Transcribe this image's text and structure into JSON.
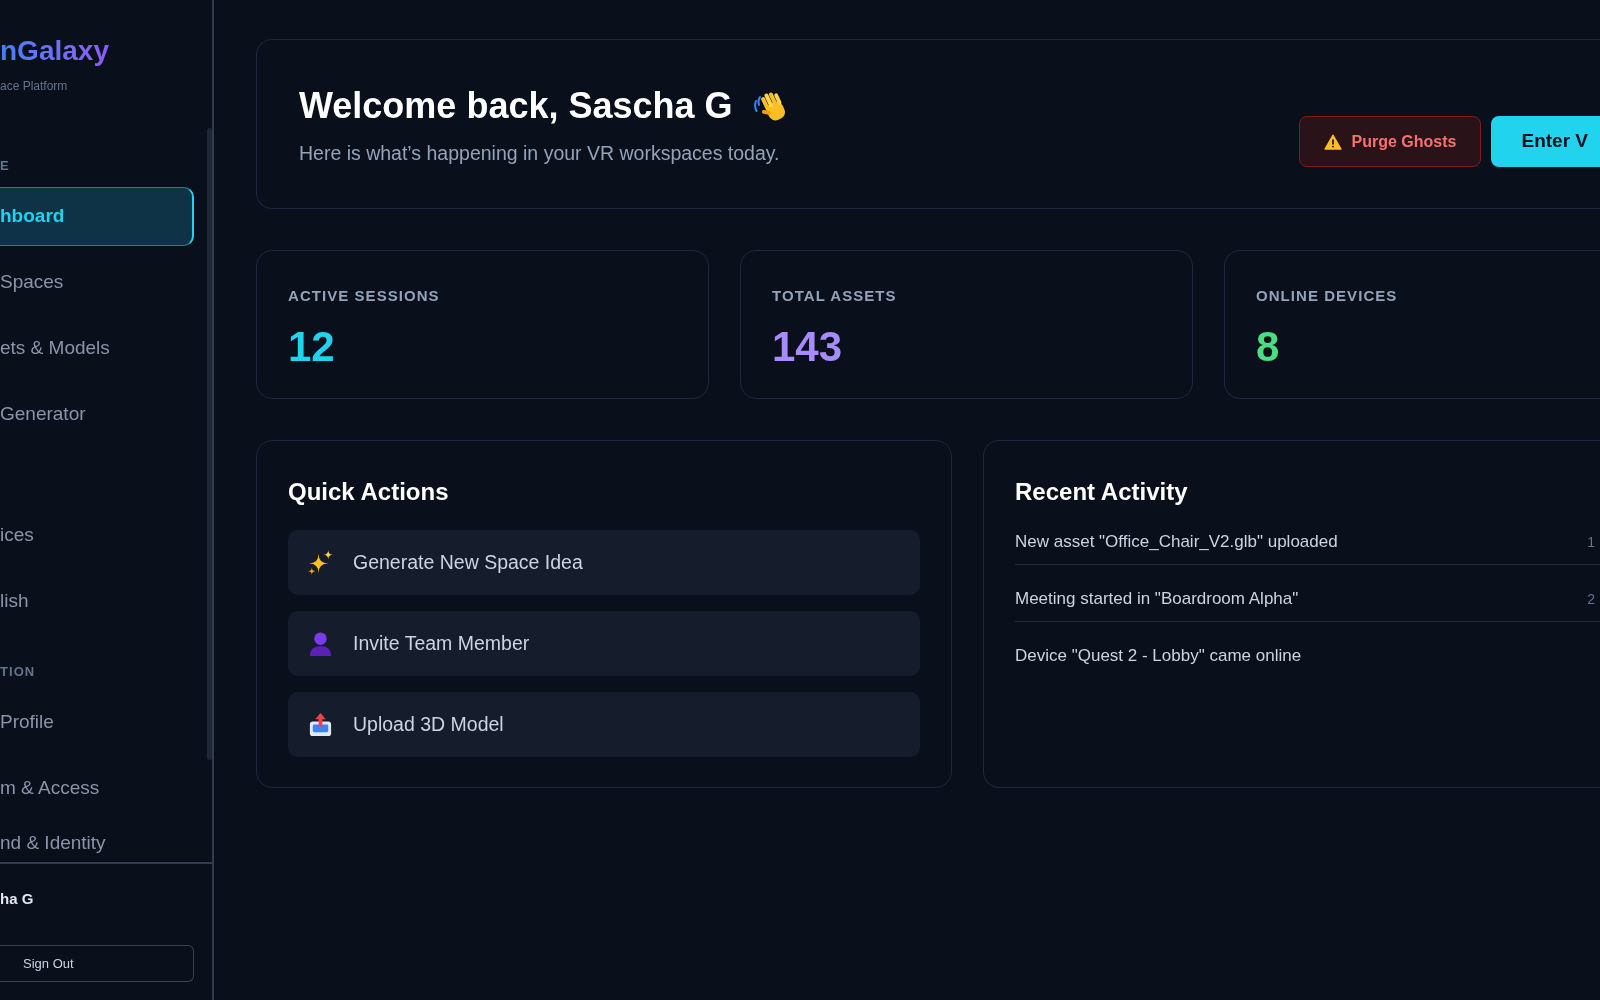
{
  "sidebar": {
    "logo": "nGalaxy",
    "tagline": "ace Platform",
    "sections": [
      {
        "label": "E",
        "items": [
          {
            "label": "hboard",
            "selected": true
          },
          {
            "label": "Spaces",
            "selected": false
          },
          {
            "label": "ets & Models",
            "selected": false
          },
          {
            "label": "Generator",
            "selected": false
          }
        ]
      },
      {
        "items": [
          {
            "label": "ices",
            "selected": false
          },
          {
            "label": "lish",
            "selected": false
          }
        ]
      },
      {
        "label": "TION",
        "items": [
          {
            "label": "Profile",
            "selected": false
          },
          {
            "label": "m & Access",
            "selected": false
          },
          {
            "label": "nd & Identity",
            "selected": false
          }
        ]
      }
    ],
    "user": {
      "name": "ha G"
    },
    "sign_out": "Sign Out"
  },
  "header": {
    "title": "Welcome back, Sascha G",
    "subtitle": "Here is what’s happening in your VR workspaces today.",
    "buttons": [
      {
        "label": "Purge Ghosts",
        "kind": "danger"
      },
      {
        "label": "Enter V",
        "kind": "primary"
      }
    ]
  },
  "stats": [
    {
      "label": "ACTIVE SESSIONS",
      "value": "12",
      "color": "#22d3ee"
    },
    {
      "label": "TOTAL ASSETS",
      "value": "143",
      "color": "#a78bfa"
    },
    {
      "label": "ONLINE DEVICES",
      "value": "8",
      "color": "#4ade80"
    }
  ],
  "quick_actions": {
    "title": "Quick Actions",
    "items": [
      {
        "label": "Generate New Space Idea",
        "kind": "generate"
      },
      {
        "label": "Invite Team Member",
        "kind": "invite"
      },
      {
        "label": "Upload 3D Model",
        "kind": "upload"
      }
    ]
  },
  "recent_activity": {
    "title": "Recent Activity",
    "items": [
      {
        "text": "New asset \"Office_Chair_V2.glb\" uploaded",
        "time": "1"
      },
      {
        "text": "Meeting started in \"Boardroom Alpha\"",
        "time": "2"
      },
      {
        "text": "Device \"Quest 2 - Lobby\" came online"
      }
    ]
  }
}
